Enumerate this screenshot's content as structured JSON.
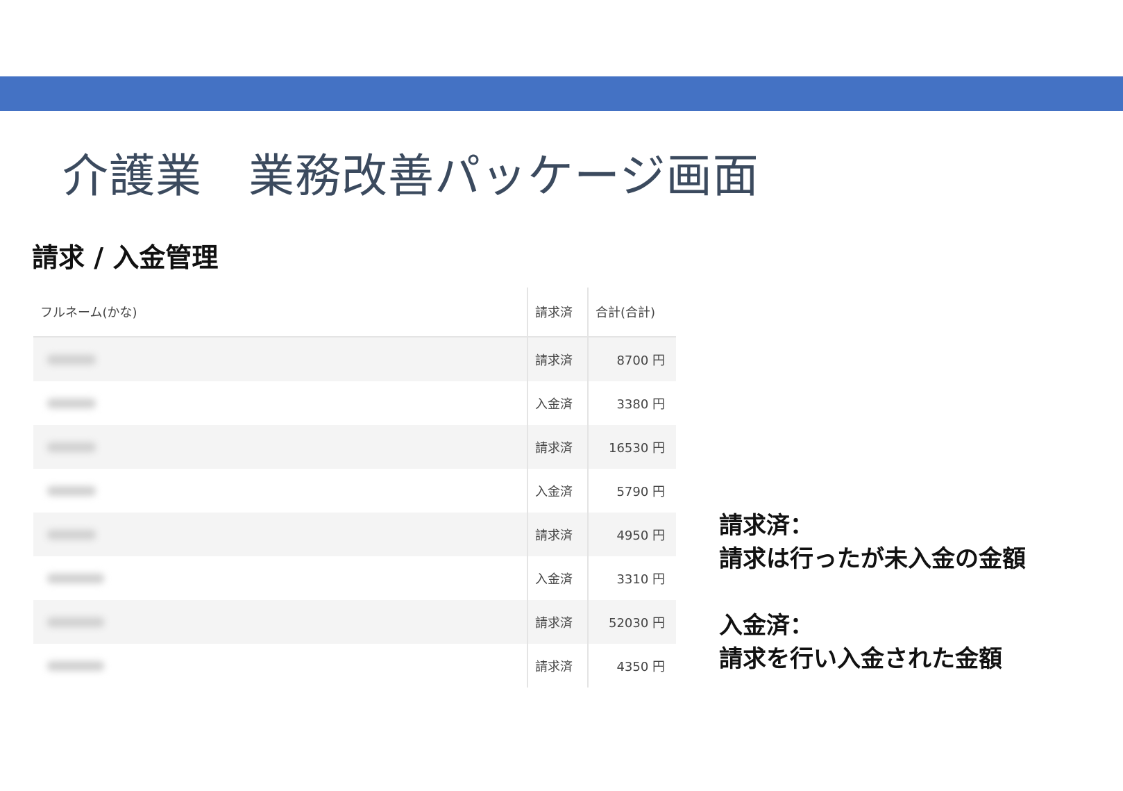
{
  "slide": {
    "title": "介護業　業務改善パッケージ画面",
    "accent_color": "#4472c4"
  },
  "section": {
    "title": "請求 / 入金管理"
  },
  "table": {
    "headers": {
      "name": "フルネーム(かな)",
      "status": "請求済",
      "total": "合計(合計)"
    },
    "rows": [
      {
        "status": "請求済",
        "total": "8700 円"
      },
      {
        "status": "入金済",
        "total": "3380 円"
      },
      {
        "status": "請求済",
        "total": "16530 円"
      },
      {
        "status": "入金済",
        "total": "5790 円"
      },
      {
        "status": "請求済",
        "total": "4950 円"
      },
      {
        "status": "入金済",
        "total": "3310 円"
      },
      {
        "status": "請求済",
        "total": "52030 円"
      },
      {
        "status": "請求済",
        "total": "4350 円"
      }
    ]
  },
  "legend": {
    "billed_term": "請求済：",
    "billed_desc": "請求は行ったが未入金の金額",
    "paid_term": "入金済：",
    "paid_desc": "請求を行い入金された金額"
  }
}
